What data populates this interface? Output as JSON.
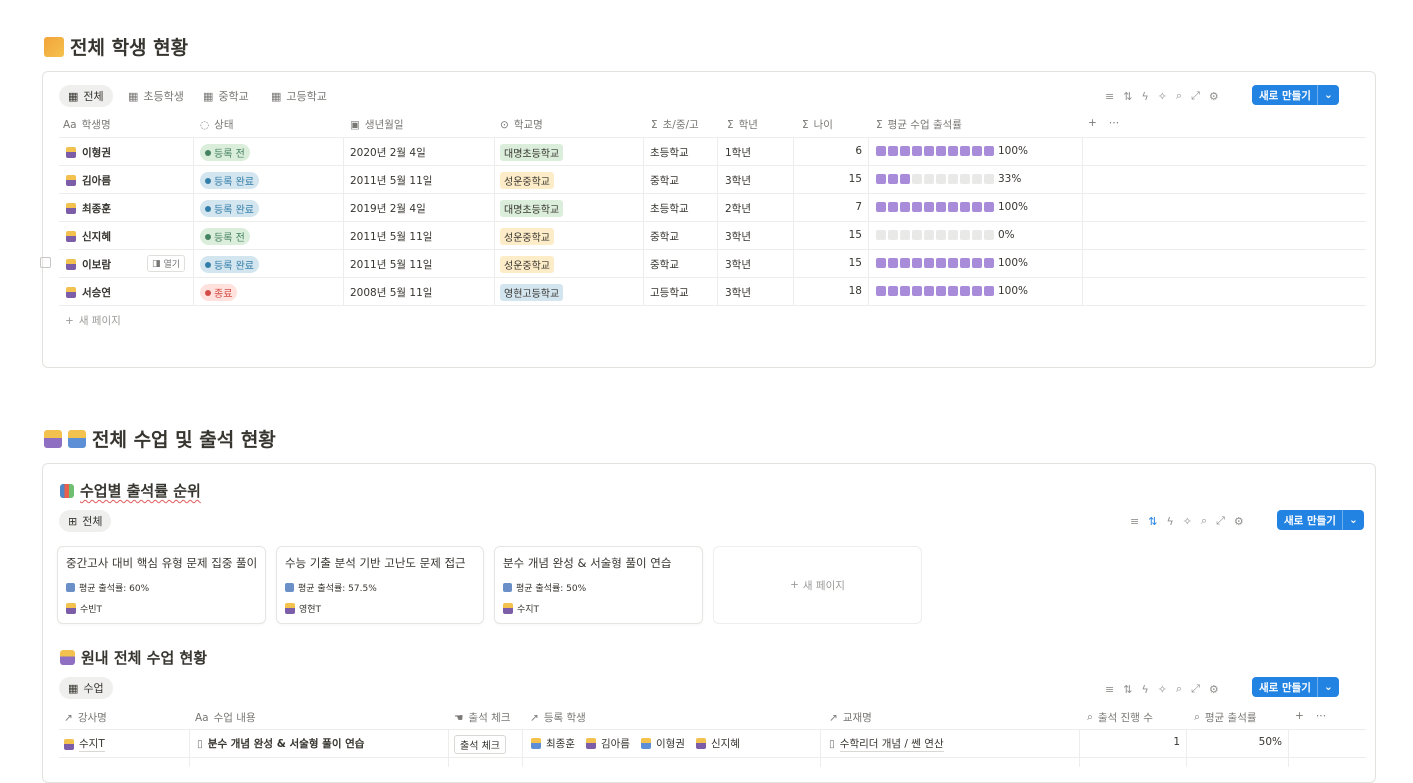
{
  "section1": {
    "title": "전체 학생 현황",
    "tabs": [
      "전체",
      "초등학생",
      "중학교",
      "고등학교"
    ],
    "new_button": "새로 만들기",
    "columns": [
      "학생명",
      "상태",
      "생년월일",
      "학교명",
      "초/중/고",
      "학년",
      "나이",
      "평균 수업 출석률"
    ],
    "rows": [
      {
        "name": "이형권",
        "status": "등록 전",
        "birth": "2020년 2월 4일",
        "school": "대명초등학교",
        "level": "초등학교",
        "grade": "1학년",
        "age": "6",
        "attendance": 1.0,
        "pct": "100%"
      },
      {
        "name": "김아름",
        "status": "등록 완료",
        "birth": "2011년 5월 11일",
        "school": "성운중학교",
        "level": "중학교",
        "grade": "3학년",
        "age": "15",
        "attendance": 0.33,
        "pct": "33%"
      },
      {
        "name": "최종훈",
        "status": "등록 완료",
        "birth": "2019년 2월 4일",
        "school": "대명초등학교",
        "level": "초등학교",
        "grade": "2학년",
        "age": "7",
        "attendance": 1.0,
        "pct": "100%"
      },
      {
        "name": "신지혜",
        "status": "등록 전",
        "birth": "2011년 5월 11일",
        "school": "성운중학교",
        "level": "중학교",
        "grade": "3학년",
        "age": "15",
        "attendance": 0.0,
        "pct": "0%"
      },
      {
        "name": "이보람",
        "status": "등록 완료",
        "birth": "2011년 5월 11일",
        "school": "성운중학교",
        "level": "중학교",
        "grade": "3학년",
        "age": "15",
        "attendance": 1.0,
        "pct": "100%"
      },
      {
        "name": "서승연",
        "status": "종료",
        "birth": "2008년 5월 11일",
        "school": "영현고등학교",
        "level": "고등학교",
        "grade": "3학년",
        "age": "18",
        "attendance": 1.0,
        "pct": "100%"
      }
    ],
    "open_label": "열기",
    "new_page": "새 페이지"
  },
  "section2": {
    "title": "전체 수업 및 출석 현황",
    "sub1": {
      "title": "수업별 출석률 순위",
      "tab": "전체",
      "new_button": "새로 만들기",
      "cards": [
        {
          "title": "중간고사 대비 핵심 유형 문제 집중 풀이",
          "rate": "평균 출석률: 60%",
          "teacher": "수빈T"
        },
        {
          "title": "수능 기출 분석 기반 고난도 문제 접근",
          "rate": "평균 출석률: 57.5%",
          "teacher": "영현T"
        },
        {
          "title": "분수 개념 완성 & 서술형 풀이 연습",
          "rate": "평균 출석률: 50%",
          "teacher": "수지T"
        }
      ],
      "new_page": "새 페이지"
    },
    "sub2": {
      "title": "원내 전체 수업 현황",
      "tab": "수업",
      "new_button": "새로 만들기",
      "columns": [
        "강사명",
        "수업 내용",
        "출석 체크",
        "등록 학생",
        "교재명",
        "출석 진행 수",
        "평균 출석률"
      ],
      "row": {
        "teacher": "수지T",
        "content": "분수 개념 완성 & 서술형 풀이 연습",
        "check": "출석 체크",
        "students": [
          "최종훈",
          "김아름",
          "이형권",
          "신지혜"
        ],
        "book": "수학리더 개념 / 쎈 연산",
        "count": "1",
        "rate": "50%"
      }
    }
  },
  "colors": {
    "accent": "#2383e2",
    "bar": "#a88cd9",
    "green_bg": "#dbeddb",
    "blue_bg": "#d3e5ef",
    "red_bg": "#ffe2dd",
    "school_green": "#dbeddb",
    "school_yellow": "#fdecc8",
    "school_blue": "#d3e5ef"
  }
}
